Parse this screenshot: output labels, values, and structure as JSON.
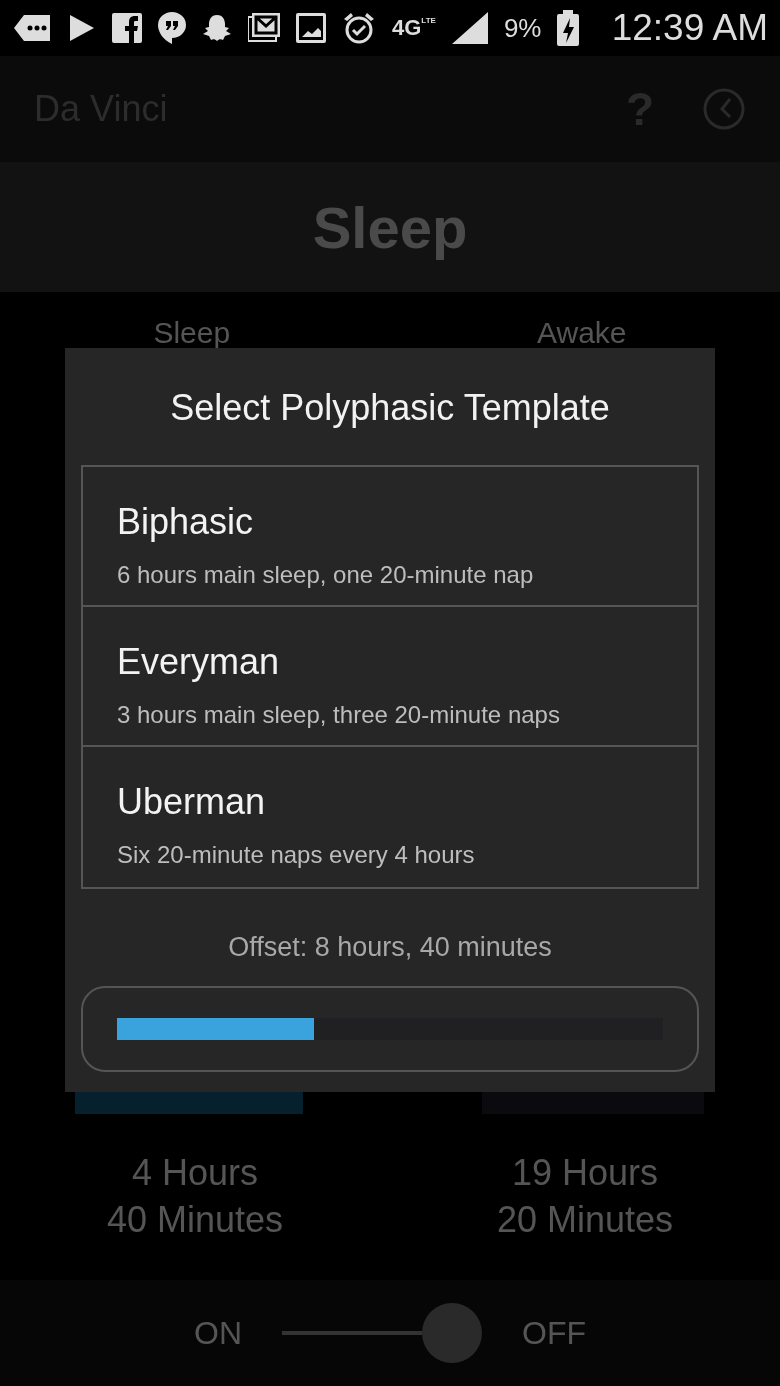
{
  "status_bar": {
    "network": "4G",
    "network_sub": "LTE",
    "battery": "9%",
    "time": "12:39 AM"
  },
  "app_bar": {
    "title": "Da Vinci",
    "help": "?"
  },
  "header": {
    "title": "Sleep"
  },
  "tabs": [
    {
      "label": "Sleep"
    },
    {
      "label": "Awake"
    }
  ],
  "durations": [
    {
      "hours": "4 Hours",
      "minutes": "40 Minutes"
    },
    {
      "hours": "19 Hours",
      "minutes": "20 Minutes"
    }
  ],
  "toggle": {
    "on_label": "ON",
    "off_label": "OFF",
    "on": false
  },
  "dialog": {
    "title": "Select Polyphasic Template",
    "templates": [
      {
        "name": "Biphasic",
        "description": "6 hours main sleep, one 20-minute nap"
      },
      {
        "name": "Everyman",
        "description": "3 hours main sleep, three 20-minute naps"
      },
      {
        "name": "Uberman",
        "description": "Six 20-minute naps every 4 hours"
      }
    ],
    "offset": {
      "label": "Offset: 8 hours, 40 minutes",
      "level": 0.36
    }
  }
}
